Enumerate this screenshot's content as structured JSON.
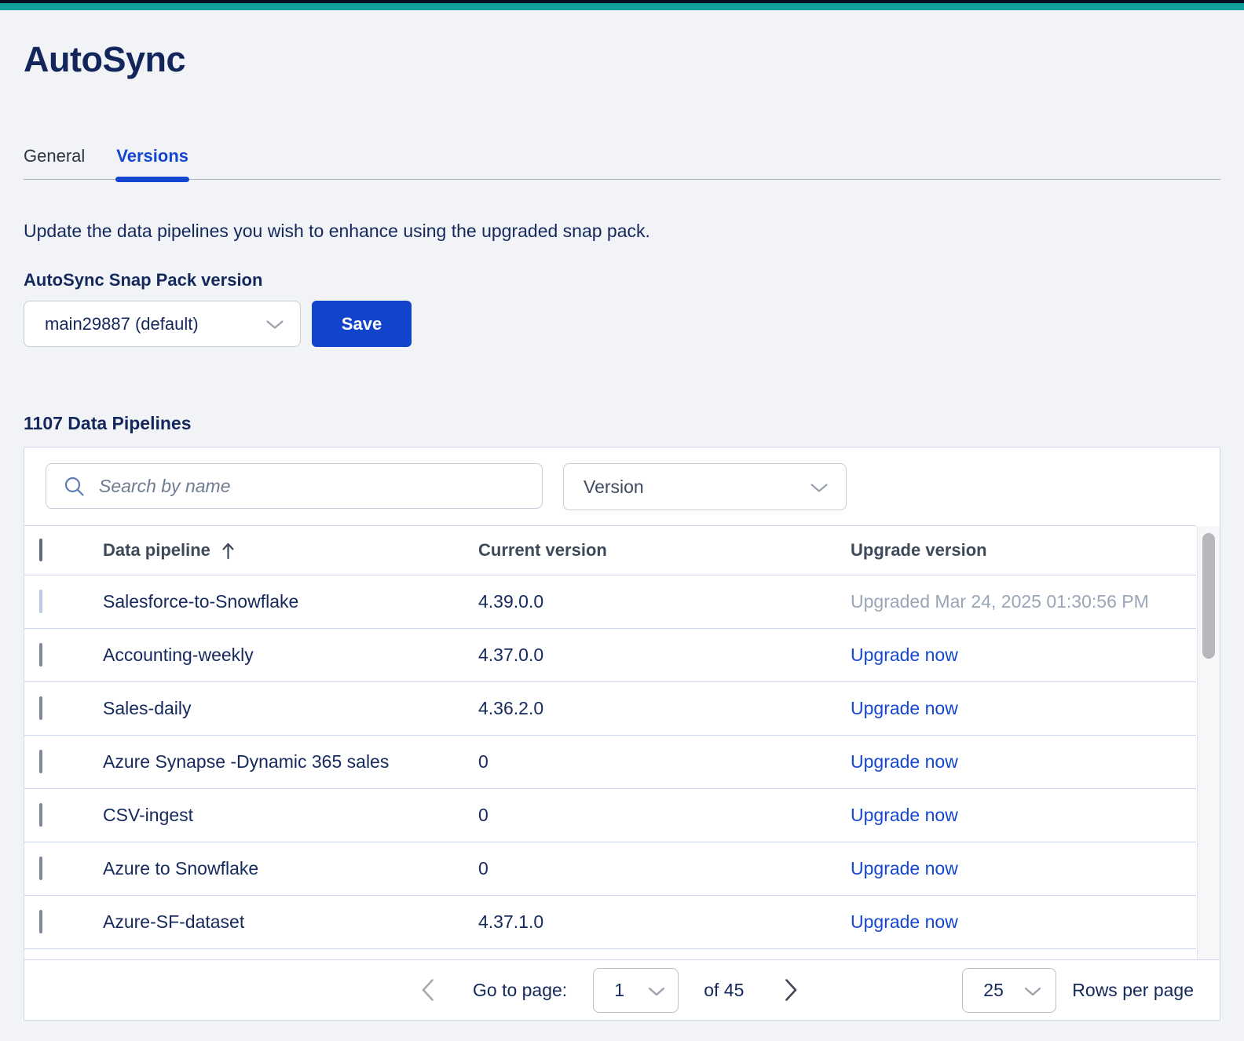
{
  "page": {
    "title": "AutoSync"
  },
  "tabs": {
    "general": "General",
    "versions": "Versions"
  },
  "description": "Update the data pipelines you wish to enhance using the upgraded snap pack.",
  "snap_pack": {
    "label": "AutoSync Snap Pack version",
    "selected_version": "main29887 (default)",
    "save_label": "Save"
  },
  "pipelines": {
    "heading": "1107 Data Pipelines",
    "search": {
      "placeholder": "Search by name"
    },
    "version_filter": {
      "label": "Version"
    },
    "table": {
      "columns": {
        "pipeline": "Data pipeline",
        "current": "Current version",
        "upgrade": "Upgrade version"
      },
      "rows": [
        {
          "name": "Salesforce-to-Snowflake",
          "current": "4.39.0.0",
          "upgrade": "Upgraded Mar 24, 2025 01:30:56 PM",
          "status": "upgraded"
        },
        {
          "name": "Accounting-weekly",
          "current": "4.37.0.0",
          "upgrade": "Upgrade now",
          "status": "link"
        },
        {
          "name": "Sales-daily",
          "current": "4.36.2.0",
          "upgrade": "Upgrade now",
          "status": "link"
        },
        {
          "name": "Azure Synapse -Dynamic 365 sales",
          "current": "0",
          "upgrade": "Upgrade now",
          "status": "link"
        },
        {
          "name": "CSV-ingest",
          "current": "0",
          "upgrade": "Upgrade now",
          "status": "link"
        },
        {
          "name": "Azure to Snowflake",
          "current": "0",
          "upgrade": "Upgrade now",
          "status": "link"
        },
        {
          "name": "Azure-SF-dataset",
          "current": "4.37.1.0",
          "upgrade": "Upgrade now",
          "status": "link"
        }
      ]
    },
    "pagination": {
      "go_to_page_label": "Go to page:",
      "current_page": "1",
      "total_label": "of 45",
      "rows_per_page_value": "25",
      "rows_per_page_label": "Rows per page"
    }
  },
  "icons": {
    "search": "search-icon",
    "chevron_down": "chevron-down-icon",
    "sort_ascending": "sort-up-arrow-icon",
    "prev_page": "chevron-left-icon",
    "next_page": "chevron-right-icon"
  },
  "colors": {
    "brand_teal": "#12a19a",
    "top_bar_dark": "#060d20",
    "accent_blue": "#1546d2",
    "button_blue": "#1243cb",
    "title_navy": "#12265c",
    "muted_gray": "#9aa5b8",
    "row_divider": "#ccd6ec"
  }
}
